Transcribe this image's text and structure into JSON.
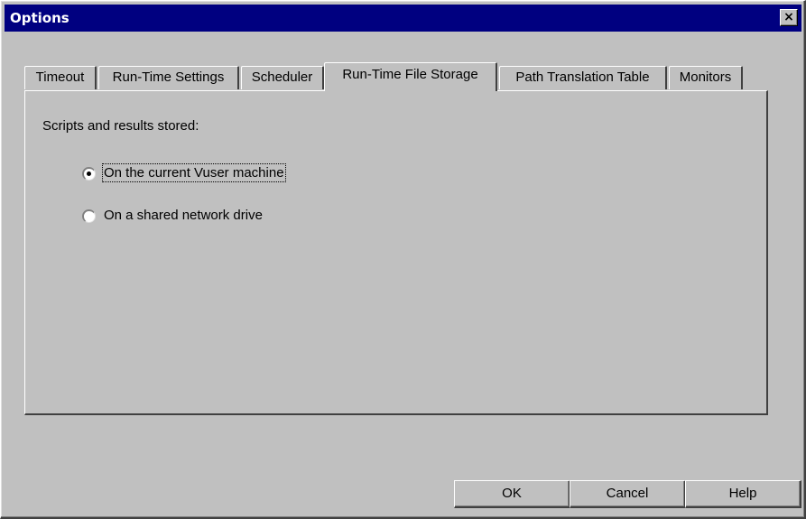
{
  "window": {
    "title": "Options",
    "close_symbol": "×"
  },
  "tabs": [
    {
      "label": "Timeout",
      "active": false
    },
    {
      "label": "Run-Time Settings",
      "active": false
    },
    {
      "label": "Scheduler",
      "active": false
    },
    {
      "label": "Run-Time File Storage",
      "active": true
    },
    {
      "label": "Path Translation Table",
      "active": false
    },
    {
      "label": "Monitors",
      "active": false
    }
  ],
  "storage": {
    "heading": "Scripts and results stored:",
    "options": [
      {
        "label": "On the current Vuser machine",
        "selected": true
      },
      {
        "label": "On a shared network drive",
        "selected": false
      }
    ]
  },
  "buttons": {
    "ok": "OK",
    "cancel": "Cancel",
    "help": "Help"
  },
  "colors": {
    "titlebar": "#000080",
    "face": "#c0c0c0"
  }
}
